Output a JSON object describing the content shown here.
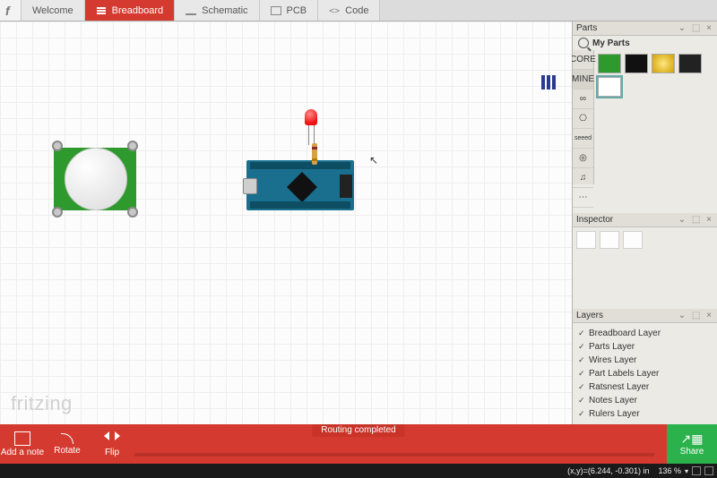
{
  "tabs": {
    "welcome": "Welcome",
    "breadboard": "Breadboard",
    "schematic": "Schematic",
    "pcb": "PCB",
    "code": "Code",
    "active": "breadboard"
  },
  "watermark": "fritzing",
  "side": {
    "parts_title": "Parts",
    "parts_label": "My Parts",
    "strip": [
      "CORE",
      "MINE",
      "∞",
      "⎔",
      "seeed",
      "◎",
      "♫",
      "⋯"
    ],
    "inspector_title": "Inspector",
    "layers_title": "Layers",
    "layers": [
      "Breadboard Layer",
      "Parts Layer",
      "Wires Layer",
      "Part Labels Layer",
      "Ratsnest Layer",
      "Notes Layer",
      "Rulers Layer"
    ],
    "dock_glyph": "⌄ ⬚ ×"
  },
  "bottombar": {
    "add_note": "Add a note",
    "rotate": "Rotate",
    "flip": "Flip",
    "routing_status": "Routing completed",
    "share": "Share"
  },
  "statusbar": {
    "coords": "(x,y)=(6.244, -0.301) in",
    "zoom": "136 %"
  },
  "components": {
    "pir": "PIR motion sensor",
    "nano": "Arduino Nano",
    "led": "Red LED",
    "resistor": "Resistor"
  },
  "colors": {
    "accent": "#d43a2f",
    "share": "#2bb24c"
  }
}
